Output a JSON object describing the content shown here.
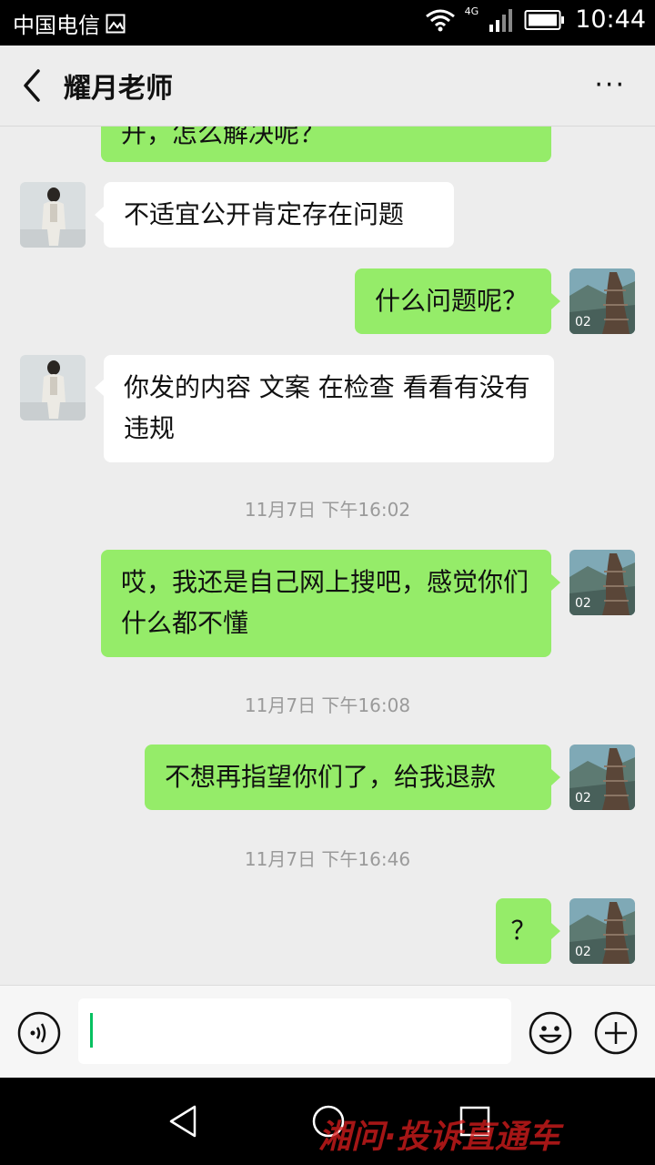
{
  "status_bar": {
    "carrier": "中国电信",
    "network": "4G",
    "time": "10:44"
  },
  "header": {
    "title": "耀月老师",
    "more_label": "···"
  },
  "messages": [
    {
      "side": "right",
      "text": "开，怎么解决呢？"
    },
    {
      "side": "left",
      "text": "不适宜公开肯定存在问题"
    },
    {
      "side": "right",
      "text": "什么问题呢？"
    },
    {
      "side": "left",
      "text": "你发的内容 文案 在检查 看看有没有违规"
    },
    {
      "side": "right",
      "text": "哎，我还是自己网上搜吧，感觉你们什么都不懂"
    },
    {
      "side": "right",
      "text": "不想再指望你们了，给我退款"
    },
    {
      "side": "right",
      "text": "？"
    }
  ],
  "timestamps": [
    "11月7日 下午16:02",
    "11月7日 下午16:08",
    "11月7日 下午16:46"
  ],
  "self_avatar_text": "02",
  "icons": {
    "voice": "voice-icon",
    "emoji": "emoji-icon",
    "plus": "plus-icon"
  },
  "watermark": "湘问·投诉直通车",
  "colors": {
    "bubble_self": "#95ec69",
    "bubble_other": "#ffffff",
    "background": "#ededed"
  }
}
